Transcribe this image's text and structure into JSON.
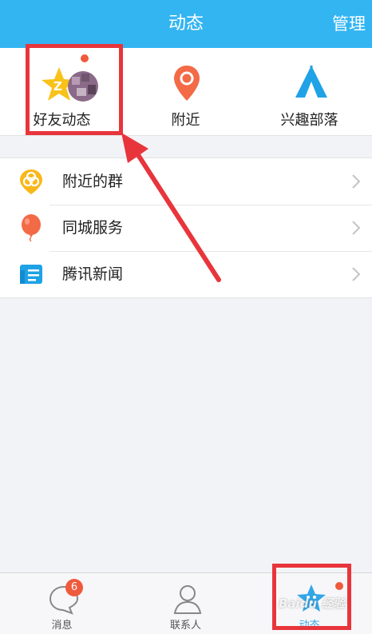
{
  "header": {
    "title": "动态",
    "manage_label": "管理"
  },
  "shortcuts": [
    {
      "label": "好友动态",
      "icon": "qzone-star-icon",
      "has_dot": true
    },
    {
      "label": "附近",
      "icon": "location-pin-icon",
      "has_dot": false
    },
    {
      "label": "兴趣部落",
      "icon": "tent-icon",
      "has_dot": false
    }
  ],
  "list": [
    {
      "label": "附近的群",
      "icon": "nearby-group-icon"
    },
    {
      "label": "同城服务",
      "icon": "balloon-icon"
    },
    {
      "label": "腾讯新闻",
      "icon": "news-icon"
    }
  ],
  "tabbar": {
    "tabs": [
      {
        "label": "消息",
        "icon": "chat-bubble-icon",
        "badge": "6"
      },
      {
        "label": "联系人",
        "icon": "contact-person-icon",
        "badge": ""
      },
      {
        "label": "动态",
        "icon": "star-activity-icon",
        "badge": "",
        "active": true
      }
    ]
  },
  "watermark": {
    "text": "Baidu 经验"
  },
  "colors": {
    "header_bg": "#33b5f2",
    "accent_red": "#e8353c",
    "badge_red": "#f05a3c",
    "active_blue": "#33a6e6"
  }
}
